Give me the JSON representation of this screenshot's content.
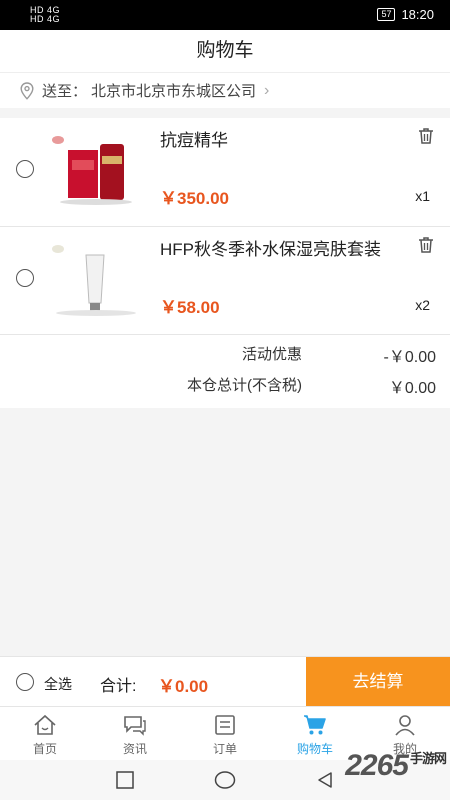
{
  "status_bar": {
    "left_lines": [
      "HD 4G",
      "HD 4G"
    ],
    "battery": "57",
    "time": "18:20"
  },
  "header": {
    "title": "购物车"
  },
  "address": {
    "prefix": "送至：",
    "text": "北京市北京市东城区公司",
    "chevron": "›"
  },
  "items": [
    {
      "name": "抗痘精华",
      "price": "￥350.00",
      "qty": "x1"
    },
    {
      "name": "HFP秋冬季补水保湿亮肤套装",
      "price": "￥58.00",
      "qty": "x2"
    }
  ],
  "summary": {
    "discount_label": "活动优惠",
    "discount_value": "-￥0.00",
    "total_label": "本仓总计(不含税)",
    "total_value": "￥0.00"
  },
  "checkout": {
    "select_all": "全选",
    "total_label": "合计:",
    "total_value": "￥0.00",
    "pay_button": "去结算"
  },
  "tabbar": [
    {
      "label": "首页",
      "icon": "home-icon"
    },
    {
      "label": "资讯",
      "icon": "chat-icon"
    },
    {
      "label": "订单",
      "icon": "order-icon"
    },
    {
      "label": "购物车",
      "icon": "cart-icon"
    },
    {
      "label": "我的",
      "icon": "user-icon"
    }
  ],
  "watermark": {
    "number": "2265",
    "text": "手游网"
  },
  "colors": {
    "accent": "#e8561f",
    "pay_button": "#f7931e",
    "active_tab": "#2ba3e6"
  }
}
